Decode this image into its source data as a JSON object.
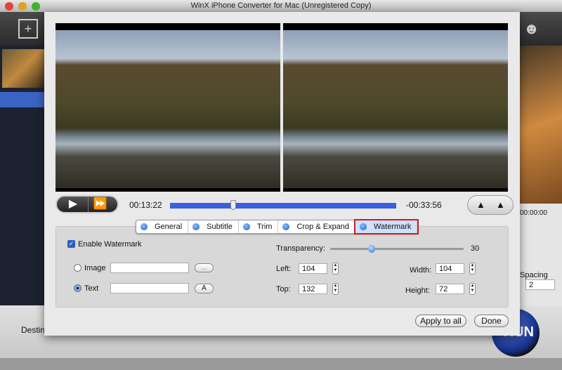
{
  "window": {
    "title": "WinX iPhone Converter for Mac (Unregistered Copy)"
  },
  "background": {
    "destination_label": "Destination Folder:",
    "right_time": "00:00:00",
    "spacing_label": "Spacing",
    "spacing_value": "2",
    "run_button": "RUN"
  },
  "player": {
    "play": "play-icon",
    "forward": "fast-forward-icon",
    "elapsed": "00:13:22",
    "remaining": "-00:33:56",
    "progress": 0.28
  },
  "tabs": [
    {
      "label": "General"
    },
    {
      "label": "Subtitle"
    },
    {
      "label": "Trim"
    },
    {
      "label": "Crop & Expand"
    },
    {
      "label": "Watermark",
      "active": true
    }
  ],
  "watermark": {
    "enable_label": "Enable Watermark",
    "enabled": true,
    "image_label": "Image",
    "image_value": "",
    "browse_label": "...",
    "text_label": "Text",
    "text_value": "",
    "font_label": "A",
    "selected_type": "Text",
    "transparency_label": "Transparency:",
    "transparency_value": "30",
    "left_label": "Left:",
    "left_value": "104",
    "top_label": "Top:",
    "top_value": "132",
    "width_label": "Width:",
    "width_value": "104",
    "height_label": "Height:",
    "height_value": "72"
  },
  "buttons": {
    "apply_all": "Apply to all",
    "done": "Done"
  }
}
